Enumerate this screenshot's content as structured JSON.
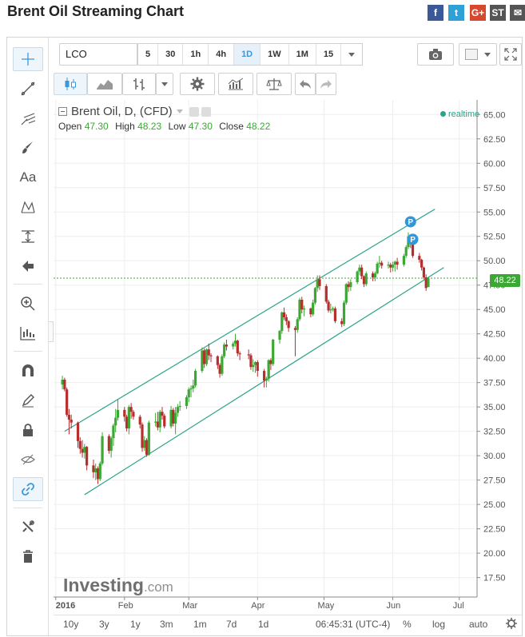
{
  "page": {
    "title": "Brent Oil Streaming Chart",
    "share_icons": [
      {
        "name": "facebook-icon",
        "glyph": "f",
        "color": "#3b5998"
      },
      {
        "name": "twitter-icon",
        "glyph": "t",
        "color": "#2fa1d6"
      },
      {
        "name": "google-plus-icon",
        "glyph": "G+",
        "color": "#d6492f"
      },
      {
        "name": "stocktwits-icon",
        "glyph": "ST",
        "color": "#555555"
      },
      {
        "name": "email-icon",
        "glyph": "✉",
        "color": "#555555"
      }
    ]
  },
  "toolbar": {
    "symbol": "LCO",
    "intervals": [
      "5",
      "30",
      "1h",
      "4h",
      "1D",
      "1W",
      "1M",
      "15"
    ],
    "active_interval": "1D"
  },
  "legend": {
    "title": "Brent Oil, D, (CFD)",
    "open_label": "Open",
    "open": "47.30",
    "high_label": "High",
    "high": "48.23",
    "low_label": "Low",
    "low": "47.30",
    "close_label": "Close",
    "close": "48.22",
    "realtime": "realtime",
    "watermark_main": "Investing",
    "watermark_suffix": ".com",
    "price_badge": "48.22"
  },
  "bottom_bar": {
    "ranges": [
      "10y",
      "3y",
      "1y",
      "3m",
      "1m",
      "7d",
      "1d"
    ],
    "time": "06:45:31 (UTC-4)",
    "percent": "%",
    "log": "log",
    "auto": "auto"
  },
  "colors": {
    "up": "#3aa832",
    "down": "#b72e2e",
    "channel": "#2ba38a",
    "close_line": "#3aa832",
    "marker": "#2d98de",
    "accent": "#3b97d9"
  },
  "chart_data": {
    "type": "candlestick",
    "title": "Brent Oil, D, (CFD)",
    "y_axis": {
      "ylim": [
        15.5,
        66.5
      ],
      "ticks": [
        "17.50",
        "20.00",
        "22.50",
        "25.00",
        "27.50",
        "30.00",
        "32.50",
        "35.00",
        "37.50",
        "40.00",
        "42.50",
        "45.00",
        "47.50",
        "50.00",
        "52.50",
        "55.00",
        "57.50",
        "60.00",
        "62.50",
        "65.00"
      ]
    },
    "x_axis": {
      "start": "2015-12-31",
      "end": "2016-07-09",
      "ticks": [
        "2016",
        "Feb",
        "Mar",
        "Apr",
        "May",
        "Jun",
        "Jul"
      ],
      "tick_dates": [
        "2016-01-01",
        "2016-02-01",
        "2016-03-01",
        "2016-04-01",
        "2016-05-01",
        "2016-06-01",
        "2016-07-01"
      ]
    },
    "last_close": 48.22,
    "channel": {
      "upper": [
        [
          "2016-01-05",
          32.5
        ],
        [
          "2016-06-20",
          55.3
        ]
      ],
      "lower": [
        [
          "2016-01-14",
          26.0
        ],
        [
          "2016-06-24",
          49.3
        ]
      ]
    },
    "markers": [
      {
        "date": "2016-06-09",
        "value": 54.0,
        "label": "P"
      },
      {
        "date": "2016-06-10",
        "value": 52.2,
        "label": "P"
      }
    ],
    "candles": [
      {
        "date": "2016-01-04",
        "open": 37.3,
        "high": 38.2,
        "low": 36.8,
        "close": 37.8
      },
      {
        "date": "2016-01-05",
        "open": 37.8,
        "high": 38.0,
        "low": 36.6,
        "close": 36.8
      },
      {
        "date": "2016-01-06",
        "open": 36.8,
        "high": 37.0,
        "low": 34.0,
        "close": 34.2
      },
      {
        "date": "2016-01-07",
        "open": 34.2,
        "high": 34.8,
        "low": 32.2,
        "close": 33.7
      },
      {
        "date": "2016-01-08",
        "open": 33.7,
        "high": 34.2,
        "low": 32.8,
        "close": 33.4
      },
      {
        "date": "2016-01-11",
        "open": 33.4,
        "high": 33.5,
        "low": 30.8,
        "close": 31.5
      },
      {
        "date": "2016-01-12",
        "open": 31.5,
        "high": 31.9,
        "low": 30.2,
        "close": 30.7
      },
      {
        "date": "2016-01-13",
        "open": 30.7,
        "high": 31.6,
        "low": 29.8,
        "close": 30.3
      },
      {
        "date": "2016-01-14",
        "open": 30.3,
        "high": 31.2,
        "low": 29.7,
        "close": 30.9
      },
      {
        "date": "2016-01-15",
        "open": 30.9,
        "high": 31.0,
        "low": 28.5,
        "close": 29.0
      },
      {
        "date": "2016-01-18",
        "open": 29.0,
        "high": 29.6,
        "low": 27.7,
        "close": 28.3
      },
      {
        "date": "2016-01-19",
        "open": 28.3,
        "high": 29.2,
        "low": 27.5,
        "close": 28.7
      },
      {
        "date": "2016-01-20",
        "open": 28.7,
        "high": 28.9,
        "low": 27.1,
        "close": 27.6
      },
      {
        "date": "2016-01-21",
        "open": 27.6,
        "high": 29.4,
        "low": 27.4,
        "close": 29.2
      },
      {
        "date": "2016-01-22",
        "open": 29.2,
        "high": 32.4,
        "low": 29.0,
        "close": 32.0
      },
      {
        "date": "2016-01-25",
        "open": 32.0,
        "high": 32.2,
        "low": 30.2,
        "close": 30.5
      },
      {
        "date": "2016-01-26",
        "open": 30.5,
        "high": 32.0,
        "low": 29.8,
        "close": 31.8
      },
      {
        "date": "2016-01-27",
        "open": 31.8,
        "high": 33.3,
        "low": 31.0,
        "close": 33.1
      },
      {
        "date": "2016-01-28",
        "open": 33.1,
        "high": 34.8,
        "low": 32.4,
        "close": 33.9
      },
      {
        "date": "2016-01-29",
        "open": 33.9,
        "high": 35.8,
        "low": 33.6,
        "close": 34.7
      },
      {
        "date": "2016-02-01",
        "open": 34.7,
        "high": 35.0,
        "low": 33.5,
        "close": 34.0
      },
      {
        "date": "2016-02-02",
        "open": 34.0,
        "high": 34.2,
        "low": 32.5,
        "close": 32.8
      },
      {
        "date": "2016-02-03",
        "open": 32.8,
        "high": 35.2,
        "low": 32.2,
        "close": 35.0
      },
      {
        "date": "2016-02-04",
        "open": 35.0,
        "high": 35.4,
        "low": 33.8,
        "close": 34.5
      },
      {
        "date": "2016-02-05",
        "open": 34.5,
        "high": 34.7,
        "low": 33.7,
        "close": 34.0
      },
      {
        "date": "2016-02-08",
        "open": 34.0,
        "high": 34.2,
        "low": 32.8,
        "close": 33.2
      },
      {
        "date": "2016-02-09",
        "open": 33.2,
        "high": 33.4,
        "low": 30.4,
        "close": 30.8
      },
      {
        "date": "2016-02-10",
        "open": 30.8,
        "high": 32.0,
        "low": 30.5,
        "close": 31.6
      },
      {
        "date": "2016-02-11",
        "open": 31.6,
        "high": 31.8,
        "low": 29.9,
        "close": 30.1
      },
      {
        "date": "2016-02-12",
        "open": 30.1,
        "high": 33.6,
        "low": 30.0,
        "close": 33.4
      },
      {
        "date": "2016-02-15",
        "open": 33.4,
        "high": 34.4,
        "low": 33.0,
        "close": 33.5
      },
      {
        "date": "2016-02-16",
        "open": 33.5,
        "high": 34.5,
        "low": 32.6,
        "close": 32.9
      },
      {
        "date": "2016-02-17",
        "open": 32.9,
        "high": 34.7,
        "low": 32.4,
        "close": 34.5
      },
      {
        "date": "2016-02-18",
        "open": 34.5,
        "high": 35.0,
        "low": 33.7,
        "close": 34.1
      },
      {
        "date": "2016-02-19",
        "open": 34.1,
        "high": 34.3,
        "low": 32.8,
        "close": 33.0
      },
      {
        "date": "2016-02-22",
        "open": 33.0,
        "high": 35.1,
        "low": 32.8,
        "close": 34.7
      },
      {
        "date": "2016-02-23",
        "open": 34.7,
        "high": 34.9,
        "low": 33.0,
        "close": 33.3
      },
      {
        "date": "2016-02-24",
        "open": 33.3,
        "high": 35.0,
        "low": 32.2,
        "close": 34.4
      },
      {
        "date": "2016-02-25",
        "open": 34.4,
        "high": 35.3,
        "low": 34.0,
        "close": 35.0
      },
      {
        "date": "2016-02-26",
        "open": 35.0,
        "high": 35.6,
        "low": 34.6,
        "close": 35.1
      },
      {
        "date": "2016-02-29",
        "open": 35.1,
        "high": 36.2,
        "low": 34.8,
        "close": 36.0
      },
      {
        "date": "2016-03-01",
        "open": 36.0,
        "high": 37.0,
        "low": 35.5,
        "close": 36.8
      },
      {
        "date": "2016-03-02",
        "open": 36.8,
        "high": 37.2,
        "low": 36.0,
        "close": 36.9
      },
      {
        "date": "2016-03-03",
        "open": 36.9,
        "high": 37.8,
        "low": 36.5,
        "close": 37.2
      },
      {
        "date": "2016-03-04",
        "open": 37.2,
        "high": 38.9,
        "low": 37.0,
        "close": 38.7
      },
      {
        "date": "2016-03-07",
        "open": 38.7,
        "high": 41.1,
        "low": 38.5,
        "close": 40.8
      },
      {
        "date": "2016-03-08",
        "open": 40.8,
        "high": 41.0,
        "low": 39.0,
        "close": 39.4
      },
      {
        "date": "2016-03-09",
        "open": 39.4,
        "high": 41.0,
        "low": 39.2,
        "close": 40.9
      },
      {
        "date": "2016-03-10",
        "open": 40.9,
        "high": 41.5,
        "low": 39.8,
        "close": 40.3
      },
      {
        "date": "2016-03-11",
        "open": 40.3,
        "high": 40.5,
        "low": 39.6,
        "close": 40.2
      },
      {
        "date": "2016-03-14",
        "open": 40.2,
        "high": 40.3,
        "low": 38.9,
        "close": 39.3
      },
      {
        "date": "2016-03-15",
        "open": 39.3,
        "high": 39.5,
        "low": 38.0,
        "close": 38.4
      },
      {
        "date": "2016-03-16",
        "open": 38.4,
        "high": 40.4,
        "low": 38.2,
        "close": 40.2
      },
      {
        "date": "2016-03-17",
        "open": 40.2,
        "high": 41.6,
        "low": 40.0,
        "close": 41.4
      },
      {
        "date": "2016-03-18",
        "open": 41.4,
        "high": 41.9,
        "low": 40.8,
        "close": 41.2
      },
      {
        "date": "2016-03-21",
        "open": 41.2,
        "high": 41.7,
        "low": 40.9,
        "close": 41.5
      },
      {
        "date": "2016-03-22",
        "open": 41.5,
        "high": 42.5,
        "low": 41.2,
        "close": 41.8
      },
      {
        "date": "2016-03-23",
        "open": 41.8,
        "high": 41.9,
        "low": 40.2,
        "close": 40.5
      },
      {
        "date": "2016-03-24",
        "open": 40.5,
        "high": 40.7,
        "low": 39.8,
        "close": 40.4
      },
      {
        "date": "2016-03-28",
        "open": 40.4,
        "high": 40.9,
        "low": 39.9,
        "close": 40.3
      },
      {
        "date": "2016-03-29",
        "open": 40.3,
        "high": 40.5,
        "low": 38.8,
        "close": 39.1
      },
      {
        "date": "2016-03-30",
        "open": 39.1,
        "high": 39.9,
        "low": 38.6,
        "close": 39.3
      },
      {
        "date": "2016-03-31",
        "open": 39.3,
        "high": 39.7,
        "low": 38.5,
        "close": 39.6
      },
      {
        "date": "2016-04-01",
        "open": 39.6,
        "high": 39.8,
        "low": 38.1,
        "close": 38.7
      },
      {
        "date": "2016-04-04",
        "open": 38.7,
        "high": 38.9,
        "low": 37.0,
        "close": 37.7
      },
      {
        "date": "2016-04-05",
        "open": 37.7,
        "high": 38.1,
        "low": 37.0,
        "close": 37.9
      },
      {
        "date": "2016-04-06",
        "open": 37.9,
        "high": 39.9,
        "low": 37.6,
        "close": 39.8
      },
      {
        "date": "2016-04-07",
        "open": 39.8,
        "high": 40.0,
        "low": 38.8,
        "close": 39.4
      },
      {
        "date": "2016-04-08",
        "open": 39.4,
        "high": 42.0,
        "low": 39.2,
        "close": 41.9
      },
      {
        "date": "2016-04-11",
        "open": 41.9,
        "high": 42.9,
        "low": 41.5,
        "close": 42.8
      },
      {
        "date": "2016-04-12",
        "open": 42.8,
        "high": 44.8,
        "low": 42.5,
        "close": 44.7
      },
      {
        "date": "2016-04-13",
        "open": 44.7,
        "high": 45.2,
        "low": 43.9,
        "close": 44.2
      },
      {
        "date": "2016-04-14",
        "open": 44.2,
        "high": 44.5,
        "low": 43.4,
        "close": 43.8
      },
      {
        "date": "2016-04-15",
        "open": 43.8,
        "high": 43.9,
        "low": 42.7,
        "close": 43.1
      },
      {
        "date": "2016-04-18",
        "open": 43.1,
        "high": 43.3,
        "low": 40.2,
        "close": 42.9
      },
      {
        "date": "2016-04-19",
        "open": 42.9,
        "high": 44.2,
        "low": 42.6,
        "close": 44.0
      },
      {
        "date": "2016-04-20",
        "open": 44.0,
        "high": 46.2,
        "low": 43.8,
        "close": 46.0
      },
      {
        "date": "2016-04-21",
        "open": 46.0,
        "high": 46.3,
        "low": 44.6,
        "close": 45.0
      },
      {
        "date": "2016-04-22",
        "open": 45.0,
        "high": 45.4,
        "low": 44.3,
        "close": 45.1
      },
      {
        "date": "2016-04-25",
        "open": 45.1,
        "high": 45.2,
        "low": 44.2,
        "close": 44.5
      },
      {
        "date": "2016-04-26",
        "open": 44.5,
        "high": 46.0,
        "low": 44.3,
        "close": 45.7
      },
      {
        "date": "2016-04-27",
        "open": 45.7,
        "high": 47.3,
        "low": 45.5,
        "close": 47.2
      },
      {
        "date": "2016-04-28",
        "open": 47.2,
        "high": 48.5,
        "low": 46.8,
        "close": 48.1
      },
      {
        "date": "2016-04-29",
        "open": 48.1,
        "high": 48.5,
        "low": 47.0,
        "close": 47.4
      },
      {
        "date": "2016-05-02",
        "open": 47.4,
        "high": 47.6,
        "low": 45.6,
        "close": 45.8
      },
      {
        "date": "2016-05-03",
        "open": 45.8,
        "high": 46.0,
        "low": 44.7,
        "close": 44.9
      },
      {
        "date": "2016-05-04",
        "open": 44.9,
        "high": 45.6,
        "low": 44.6,
        "close": 45.0
      },
      {
        "date": "2016-05-05",
        "open": 45.0,
        "high": 45.3,
        "low": 44.8,
        "close": 45.1
      },
      {
        "date": "2016-05-06",
        "open": 45.1,
        "high": 45.3,
        "low": 43.6,
        "close": 43.8
      },
      {
        "date": "2016-05-09",
        "open": 43.8,
        "high": 44.1,
        "low": 43.2,
        "close": 43.5
      },
      {
        "date": "2016-05-10",
        "open": 43.5,
        "high": 45.9,
        "low": 43.3,
        "close": 45.7
      },
      {
        "date": "2016-05-11",
        "open": 45.7,
        "high": 47.7,
        "low": 45.5,
        "close": 47.6
      },
      {
        "date": "2016-05-12",
        "open": 47.6,
        "high": 47.9,
        "low": 46.8,
        "close": 47.3
      },
      {
        "date": "2016-05-13",
        "open": 47.3,
        "high": 48.1,
        "low": 46.9,
        "close": 47.8
      },
      {
        "date": "2016-05-16",
        "open": 47.8,
        "high": 49.0,
        "low": 47.6,
        "close": 48.9
      },
      {
        "date": "2016-05-17",
        "open": 48.9,
        "high": 49.6,
        "low": 48.5,
        "close": 49.3
      },
      {
        "date": "2016-05-18",
        "open": 49.3,
        "high": 49.6,
        "low": 48.1,
        "close": 48.4
      },
      {
        "date": "2016-05-19",
        "open": 48.4,
        "high": 48.5,
        "low": 47.3,
        "close": 47.6
      },
      {
        "date": "2016-05-20",
        "open": 47.6,
        "high": 48.9,
        "low": 47.4,
        "close": 48.7
      },
      {
        "date": "2016-05-23",
        "open": 48.7,
        "high": 48.9,
        "low": 47.9,
        "close": 48.3
      },
      {
        "date": "2016-05-24",
        "open": 48.3,
        "high": 48.9,
        "low": 47.9,
        "close": 48.7
      },
      {
        "date": "2016-05-25",
        "open": 48.7,
        "high": 49.9,
        "low": 48.6,
        "close": 49.7
      },
      {
        "date": "2016-05-26",
        "open": 49.7,
        "high": 50.5,
        "low": 49.3,
        "close": 49.8
      },
      {
        "date": "2016-05-27",
        "open": 49.8,
        "high": 50.0,
        "low": 49.2,
        "close": 49.5
      },
      {
        "date": "2016-05-30",
        "open": 49.5,
        "high": 49.9,
        "low": 49.2,
        "close": 49.6
      },
      {
        "date": "2016-05-31",
        "open": 49.6,
        "high": 49.8,
        "low": 48.8,
        "close": 49.3
      },
      {
        "date": "2016-06-01",
        "open": 49.3,
        "high": 49.9,
        "low": 48.9,
        "close": 49.6
      },
      {
        "date": "2016-06-02",
        "open": 49.6,
        "high": 50.0,
        "low": 48.9,
        "close": 49.9
      },
      {
        "date": "2016-06-03",
        "open": 49.9,
        "high": 50.3,
        "low": 49.1,
        "close": 49.6
      },
      {
        "date": "2016-06-06",
        "open": 49.6,
        "high": 50.7,
        "low": 49.4,
        "close": 50.5
      },
      {
        "date": "2016-06-07",
        "open": 50.5,
        "high": 51.6,
        "low": 50.3,
        "close": 51.4
      },
      {
        "date": "2016-06-08",
        "open": 51.4,
        "high": 52.9,
        "low": 51.2,
        "close": 52.5
      },
      {
        "date": "2016-06-09",
        "open": 52.5,
        "high": 52.6,
        "low": 51.3,
        "close": 52.0
      },
      {
        "date": "2016-06-10",
        "open": 52.0,
        "high": 52.2,
        "low": 50.3,
        "close": 50.5
      },
      {
        "date": "2016-06-13",
        "open": 50.5,
        "high": 50.8,
        "low": 49.8,
        "close": 50.1
      },
      {
        "date": "2016-06-14",
        "open": 50.1,
        "high": 50.2,
        "low": 49.0,
        "close": 49.3
      },
      {
        "date": "2016-06-15",
        "open": 49.3,
        "high": 49.4,
        "low": 48.1,
        "close": 48.3
      },
      {
        "date": "2016-06-16",
        "open": 48.3,
        "high": 48.6,
        "low": 46.9,
        "close": 47.2
      },
      {
        "date": "2016-06-17",
        "open": 47.3,
        "high": 48.23,
        "low": 47.3,
        "close": 48.22
      }
    ]
  }
}
